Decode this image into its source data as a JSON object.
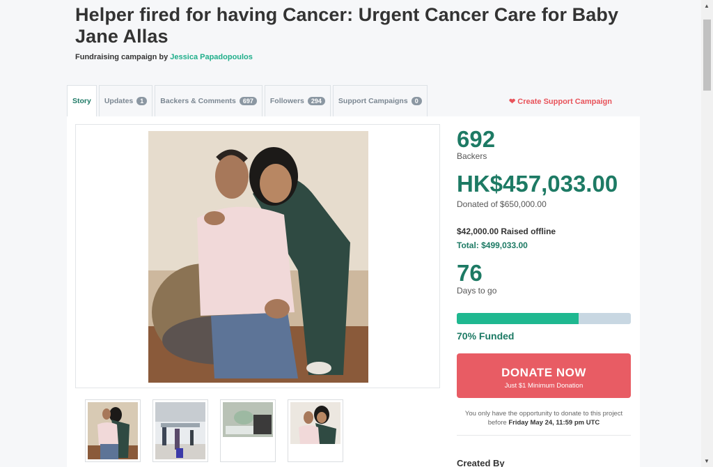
{
  "campaign": {
    "title": "Helper fired for having Cancer: Urgent Cancer Care for Baby Jane Allas",
    "byline_prefix": "Fundraising campaign by ",
    "author": "Jessica Papadopoulos"
  },
  "tabs": [
    {
      "label": "Story",
      "count": null
    },
    {
      "label": "Updates",
      "count": "1"
    },
    {
      "label": "Backers & Comments",
      "count": "697"
    },
    {
      "label": "Followers",
      "count": "294"
    },
    {
      "label": "Support Campaigns",
      "count": "0"
    }
  ],
  "support_link": "Create Support Campaign",
  "stats": {
    "backers_num": "692",
    "backers_label": "Backers",
    "donated_num": "HK$457,033.00",
    "donated_label": "Donated of $650,000.00",
    "offline": "$42,000.00 Raised offline",
    "total": "Total: $499,033.00",
    "days_num": "76",
    "days_label": "Days to go",
    "funded_fraction": 0.7,
    "funded_text": "70% Funded"
  },
  "donate": {
    "label": "DONATE NOW",
    "sublabel": "Just $1 Minimum Donation"
  },
  "deadline": {
    "prefix": "You only have the opportunity to donate to this project before ",
    "date": "Friday May 24, 11:59 pm UTC"
  },
  "created_by": "Created By",
  "colors": {
    "accent": "#1d7a64",
    "donate": "#e85c64",
    "progress_fill": "#1fb890"
  }
}
